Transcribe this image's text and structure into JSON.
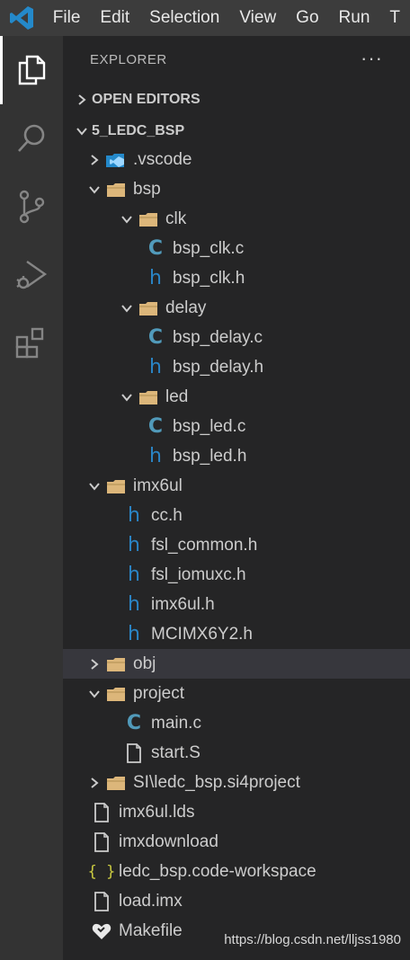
{
  "menubar": {
    "items": [
      "File",
      "Edit",
      "Selection",
      "View",
      "Go",
      "Run",
      "T"
    ]
  },
  "activity_bar": {
    "items": [
      "files-icon",
      "search-icon",
      "source-control-icon",
      "run-debug-icon",
      "extensions-icon"
    ],
    "active": "files-icon"
  },
  "explorer": {
    "title": "EXPLORER",
    "more": "···",
    "open_editors": "OPEN EDITORS",
    "root": "5_LEDC_BSP",
    "tree": [
      {
        "label": ".vscode",
        "kind": "folder-vscode",
        "depth": 1,
        "state": "collapsed"
      },
      {
        "label": "bsp",
        "kind": "folder",
        "depth": 1,
        "state": "expanded"
      },
      {
        "label": "clk",
        "kind": "folder",
        "depth": 2,
        "state": "expanded"
      },
      {
        "label": "bsp_clk.c",
        "kind": "c",
        "depth": 3
      },
      {
        "label": "bsp_clk.h",
        "kind": "h",
        "depth": 3
      },
      {
        "label": "delay",
        "kind": "folder",
        "depth": 2,
        "state": "expanded"
      },
      {
        "label": "bsp_delay.c",
        "kind": "c",
        "depth": 3
      },
      {
        "label": "bsp_delay.h",
        "kind": "h",
        "depth": 3
      },
      {
        "label": "led",
        "kind": "folder",
        "depth": 2,
        "state": "expanded"
      },
      {
        "label": "bsp_led.c",
        "kind": "c",
        "depth": 3
      },
      {
        "label": "bsp_led.h",
        "kind": "h",
        "depth": 3
      },
      {
        "label": "imx6ul",
        "kind": "folder",
        "depth": 1,
        "state": "expanded"
      },
      {
        "label": "cc.h",
        "kind": "h",
        "depth": 2
      },
      {
        "label": "fsl_common.h",
        "kind": "h",
        "depth": 2
      },
      {
        "label": "fsl_iomuxc.h",
        "kind": "h",
        "depth": 2
      },
      {
        "label": "imx6ul.h",
        "kind": "h",
        "depth": 2
      },
      {
        "label": "MCIMX6Y2.h",
        "kind": "h",
        "depth": 2
      },
      {
        "label": "obj",
        "kind": "folder",
        "depth": 1,
        "state": "collapsed",
        "selected": true
      },
      {
        "label": "project",
        "kind": "folder",
        "depth": 1,
        "state": "expanded"
      },
      {
        "label": "main.c",
        "kind": "c",
        "depth": 2
      },
      {
        "label": "start.S",
        "kind": "file",
        "depth": 2
      },
      {
        "label": "SI\\ledc_bsp.si4project",
        "kind": "folder",
        "depth": 1,
        "state": "collapsed"
      },
      {
        "label": "imx6ul.lds",
        "kind": "file",
        "depth": 1
      },
      {
        "label": "imxdownload",
        "kind": "file",
        "depth": 1
      },
      {
        "label": "ledc_bsp.code-workspace",
        "kind": "json",
        "depth": 1
      },
      {
        "label": "load.imx",
        "kind": "file",
        "depth": 1
      },
      {
        "label": "Makefile",
        "kind": "makefile",
        "depth": 1
      }
    ]
  },
  "watermark": "https://blog.csdn.net/lljss1980",
  "colors": {
    "folder": "#dcb67a",
    "c_file": "#519aba",
    "h_file": "#2a84c4",
    "json": "#cbcb41",
    "selected_row": "#37373d",
    "vscode_blue": "#2489ca"
  }
}
